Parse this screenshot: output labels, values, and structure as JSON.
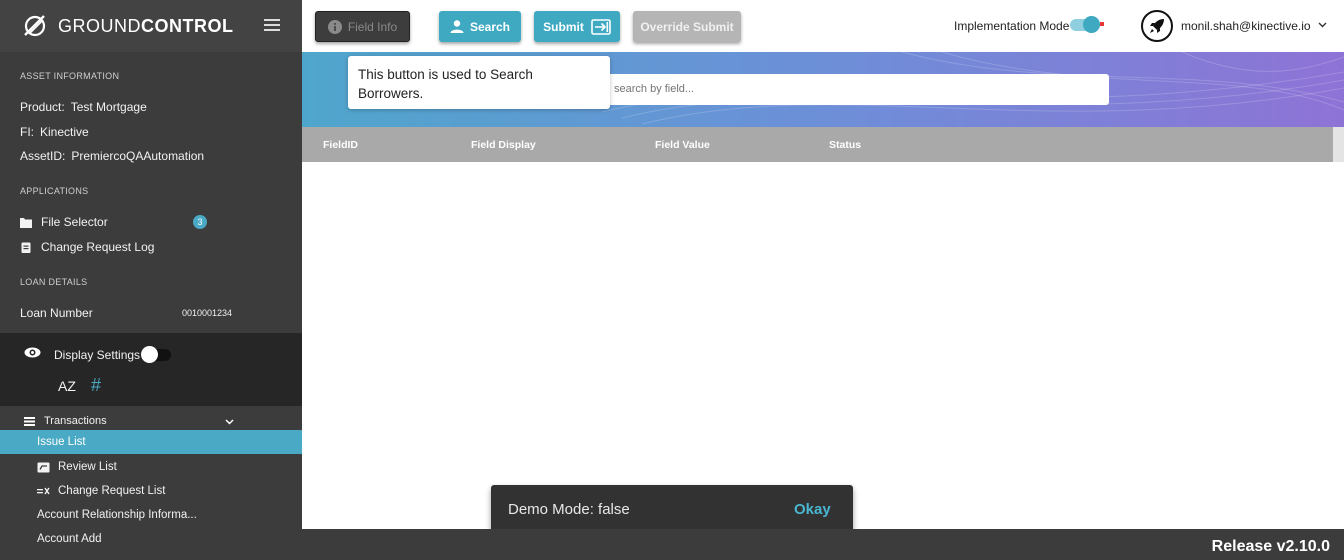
{
  "brand": {
    "name_light": "GROUND",
    "name_bold": "CONTROL"
  },
  "sidebar": {
    "asset_title": "ASSET INFORMATION",
    "product_key": "Product:",
    "product_val": "Test Mortgage",
    "fi_key": "FI:",
    "fi_val": "Kinective",
    "asset_key": "AssetID:",
    "asset_val": "PremiercoQAAutomation",
    "apps_title": "APPLICATIONS",
    "apps": [
      {
        "label": "File Selector",
        "icon": "folder-icon",
        "badge": "3"
      },
      {
        "label": "Change Request Log",
        "icon": "clipboard-icon"
      }
    ],
    "loan_title": "LOAN DETAILS",
    "loan_key": "Loan Number",
    "loan_val": "0010001234",
    "display_settings": "Display Settings",
    "display_toggle_on": false,
    "sort_az": "AZ",
    "hash": "#",
    "transactions": "Transactions",
    "nav": [
      {
        "label": "Issue List",
        "active": true
      },
      {
        "label": "Review List",
        "icon": "review-icon"
      },
      {
        "label": "Change Request List",
        "icon": "change-request-icon"
      },
      {
        "label": "Account Relationship Informa..."
      },
      {
        "label": "Account Add"
      }
    ]
  },
  "toolbar": {
    "field_info": "Field Info",
    "search": "Search",
    "submit": "Submit",
    "override_submit": "Override Submit",
    "implementation_mode": "Implementation Mode",
    "implementation_on": true,
    "user_email": "monil.shah@kinective.io"
  },
  "search": {
    "placeholder": "search by field..."
  },
  "tooltip": {
    "text": "This button is used to Search Borrowers."
  },
  "table": {
    "headers": [
      "FieldID",
      "Field Display",
      "Field Value",
      "Status"
    ]
  },
  "snackbar": {
    "message": "Demo Mode: false",
    "action": "Okay"
  },
  "footer": {
    "release": "Release v2.10.0"
  },
  "colors": {
    "accent": "#3fa9c2",
    "sidebar": "#3c3c3c",
    "header_row": "#a9a9a9"
  }
}
